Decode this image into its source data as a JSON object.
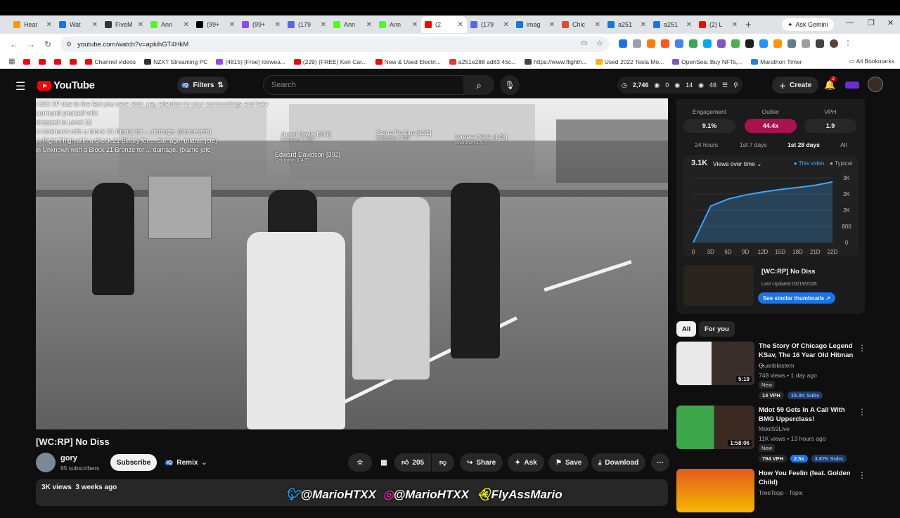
{
  "browser": {
    "tabs": [
      {
        "label": "Hear",
        "color": "#f59b00"
      },
      {
        "label": "Wat",
        "color": "#1a73e8"
      },
      {
        "label": "FiveM",
        "color": "#333333"
      },
      {
        "label": "Ann",
        "color": "#53fc18"
      },
      {
        "label": "(99+",
        "color": "#000000"
      },
      {
        "label": "(99+",
        "color": "#9146ff"
      },
      {
        "label": "(179",
        "color": "#5865f2"
      },
      {
        "label": "Ann",
        "color": "#53fc18"
      },
      {
        "label": "Ann",
        "color": "#53fc18"
      },
      {
        "label": "(2",
        "color": "#ff0000",
        "active": true
      },
      {
        "label": "(179",
        "color": "#5865f2"
      },
      {
        "label": "imag",
        "color": "#1a73e8"
      },
      {
        "label": "Chic",
        "color": "#ea4335"
      },
      {
        "label": "a251",
        "color": "#1a73e8"
      },
      {
        "label": "a251",
        "color": "#1a73e8"
      },
      {
        "label": "(2) L",
        "color": "#ff0000"
      }
    ],
    "ask_gemini": "Ask Gemini",
    "url": "youtube.com/watch?v=apkihGT4HkM",
    "bookmarks": [
      "Channel videos",
      "NZXT Streaming PC",
      "(4815) [Free] Icewea...",
      "(229) (FREE) Ken Car...",
      "New & Used Electri...",
      "a251e288 ad83 45c...",
      "https://www.flighth...",
      "Used 2022 Tesla Mo...",
      "OpenSea: Buy NFTs,...",
      "Marathon Timer"
    ],
    "all_bookmarks": "All Bookmarks"
  },
  "youtube": {
    "logo_text": "YouTube",
    "filters": "Filters",
    "search_placeholder": "Search",
    "stats": {
      "views": "2,746",
      "a": "0",
      "b": "14",
      "c": "46"
    },
    "create": "Create",
    "notif_count": "2"
  },
  "video": {
    "killfeed": [
      "t 500 XP due to the fact you were shot, pay attention to your surroundings and take",
      "surround yourself with",
      "dropped to Level 12",
      "in Unknown with a Glock 21 Binary for ... damage. (blame jefe)",
      "in Right Thigh with a Glock 21 Binary for ... damage. (blame jefe)",
      "in Unknown with a Block 21 Bronze for ... damage. (blame jefe)"
    ],
    "nametags": [
      {
        "name": "Jason Davis [397]",
        "sub": "Unknown 1 5'8\""
      },
      {
        "name": "Sema Perkins [131]",
        "sub": "Unknown 1 5'8\""
      },
      {
        "name": "Tyreese Nola [148]",
        "sub": "Unknown 1 5'7\""
      },
      {
        "name": "Edward Davidson [392]",
        "sub": "Unknown 1 4'9\""
      }
    ],
    "title": "[WC:RP] No Diss",
    "channel": "gory",
    "subscribers": "95 subscribers",
    "subscribe": "Subscribe",
    "remix": "Remix",
    "likes": "205",
    "share": "Share",
    "ask": "Ask",
    "save": "Save",
    "download": "Download",
    "views_date": "3K views  3 weeks ago"
  },
  "watermark": {
    "twitter": "@MarioHTXX",
    "instagram": "@MarioHTXX",
    "snapchat": "FlyAssMario"
  },
  "panel": {
    "metrics": [
      {
        "label": "Engagement",
        "value": "9.1%"
      },
      {
        "label": "Outlier",
        "value": "44.4x"
      },
      {
        "label": "VPH",
        "value": "1.9"
      }
    ],
    "ranges": [
      "24 hours",
      "1st 7 days",
      "1st 28 days",
      "All"
    ],
    "selected_range": "1st 28 days",
    "chart_value": "3.1K",
    "chart_mode": "Views over time",
    "legend_this": "This video",
    "legend_typical": "Typical",
    "video_title": "[WC:RP] No Diss",
    "last_updated": "Last Updated 03/19/2026",
    "similar_btn": "See similar thumbnails"
  },
  "chart_data": {
    "type": "area",
    "title": "Views over time",
    "x": [
      "0",
      "3D",
      "6D",
      "9D",
      "12D",
      "15D",
      "18D",
      "21D",
      "22D"
    ],
    "series": [
      {
        "name": "This video",
        "values": [
          0,
          1800,
          2150,
          2350,
          2500,
          2620,
          2720,
          2830,
          3000
        ]
      }
    ],
    "ytick_labels": [
      "0",
      "800",
      "2K",
      "2K",
      "3K"
    ],
    "xlabel": "",
    "ylabel": "",
    "ylim": [
      0,
      3200
    ],
    "color": "#3ea6ff"
  },
  "chips": [
    "All",
    "For you"
  ],
  "recommendations": [
    {
      "title": "The Story Of Chicago Legend KSav, The 16 Year Old Hitman ...",
      "channel": "Quanblastem",
      "meta": "748 views • 1 day ago",
      "badge": "New",
      "duration": "5:19",
      "vph": "14 VPH",
      "subs": "15.3K Subs"
    },
    {
      "title": "Mdot 59 Gets In A Call With BMG Upperclass!",
      "channel": "Mdot59Live",
      "meta": "11K views • 13 hours ago",
      "badge": "New",
      "duration": "1:58:06",
      "vph": "794 VPH",
      "ratio": "2.5x",
      "subs": "3.87K Subs"
    },
    {
      "title": "How You Feelin (feat. Golden Child)",
      "channel": "TreeTopp - Topic"
    }
  ]
}
